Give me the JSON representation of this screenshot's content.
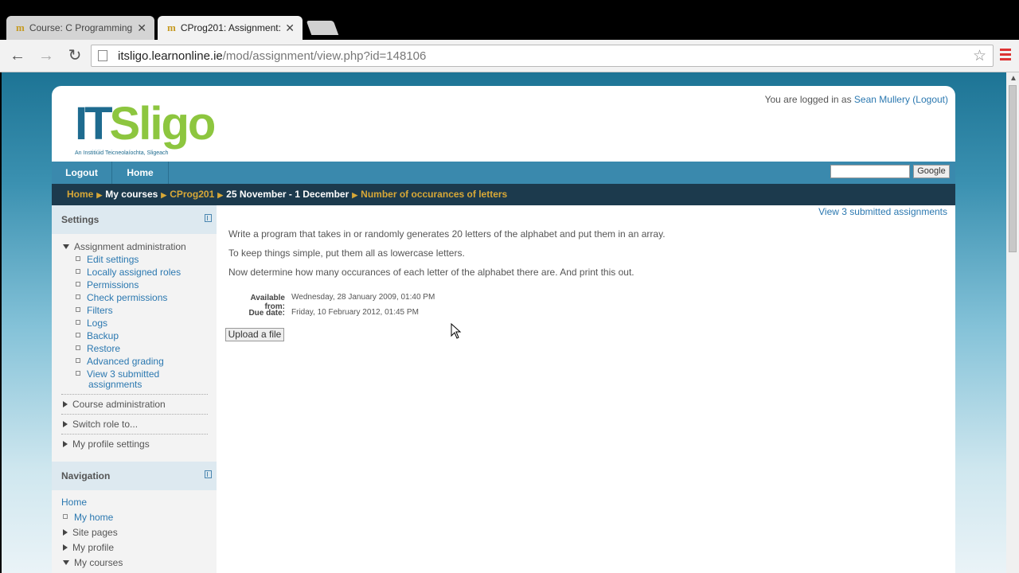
{
  "browser": {
    "tabs": [
      {
        "title": "Course: C Programming",
        "active": false
      },
      {
        "title": "CProg201: Assignment:",
        "active": true
      }
    ],
    "url_host": "itsligo.learnonline.ie",
    "url_path": "/mod/assignment/view.php?id=148106"
  },
  "header": {
    "logo_it": "IT",
    "logo_sligo": "Sligo",
    "logo_subtitle": "An Institiúid Teicneolaíochta, Sligeach",
    "logged_in_prefix": "You are logged in as",
    "user_name": "Sean Mullery",
    "logout_link": "(Logout)"
  },
  "navbar": {
    "items": [
      "Logout",
      "Home"
    ],
    "search_button": "Google"
  },
  "breadcrumb": {
    "items": [
      "Home",
      "My courses",
      "CProg201",
      "25 November - 1 December",
      "Number of occurances of letters"
    ]
  },
  "settings": {
    "title": "Settings",
    "assignment_admin": "Assignment administration",
    "links": [
      "Edit settings",
      "Locally assigned roles",
      "Permissions",
      "Check permissions",
      "Filters",
      "Logs",
      "Backup",
      "Restore",
      "Advanced grading"
    ],
    "view_submitted_line1": "View 3 submitted",
    "view_submitted_line2": "assignments",
    "course_admin": "Course administration",
    "switch_role": "Switch role to...",
    "profile_settings": "My profile settings"
  },
  "navigation": {
    "title": "Navigation",
    "home": "Home",
    "my_home": "My home",
    "site_pages": "Site pages",
    "my_profile": "My profile",
    "my_courses": "My courses"
  },
  "main": {
    "view_submitted": "View 3 submitted assignments",
    "paragraphs": [
      "Write a program that takes in or randomly generates 20 letters of the alphabet  and put them in an array.",
      "To keep things simple, put them all as lowercase letters.",
      "Now determine how many occurances of each letter of the alphabet there are. And print this out."
    ],
    "available_label": "Available from:",
    "available_value": "Wednesday, 28 January 2009, 01:40 PM",
    "due_label": "Due date:",
    "due_value": "Friday, 10 February 2012, 01:45 PM",
    "upload_button": "Upload a file"
  }
}
